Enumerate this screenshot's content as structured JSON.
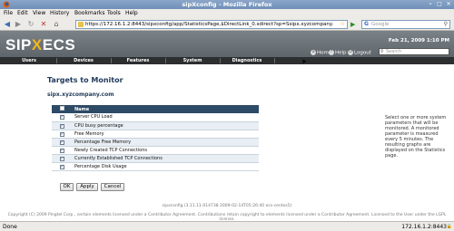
{
  "window": {
    "title": "sipXconfig - Mozilla Firefox"
  },
  "menu": [
    "File",
    "Edit",
    "View",
    "History",
    "Bookmarks",
    "Tools",
    "Help"
  ],
  "browser": {
    "url": "https://172.16.1.2:8443/sipxconfig/app/StatisticsPage,$DirectLink_0.sdirect?sp=Ssipx.xyzcompany.",
    "search_placeholder": "Google"
  },
  "app": {
    "logo_left": "SIP",
    "logo_x": "X",
    "logo_right": "ECS",
    "date": "Feb 21, 2009 1:10 PM",
    "links": {
      "home": "Home",
      "help": "Help",
      "logout": "Logout"
    },
    "search_placeholder": "Search",
    "nav": [
      "Users",
      "Devices",
      "Features",
      "System",
      "Diagnostics"
    ]
  },
  "page": {
    "heading": "Targets to Monitor",
    "server": "sipx.xyzcompany.com",
    "table": {
      "column_name": "Name",
      "rows": [
        {
          "checked": true,
          "name": "Server CPU Load"
        },
        {
          "checked": true,
          "name": "CPU busy percentage"
        },
        {
          "checked": true,
          "name": "Free Memory"
        },
        {
          "checked": true,
          "name": "Percentage Free Memory"
        },
        {
          "checked": true,
          "name": "Newly Created TCP Connections"
        },
        {
          "checked": true,
          "name": "Currently Established TCP Connections"
        },
        {
          "checked": true,
          "name": "Percentage Disk Usage"
        }
      ]
    },
    "buttons": {
      "ok": "OK",
      "apply": "Apply",
      "cancel": "Cancel"
    },
    "sidenote": "Select one or more system parameters that will be monitored. A monitored parameter is measured every 5 minutes. The resulting graphs are displayed on the Statistics page.",
    "footer_version": "sipxconfig (3.11.11-014738 2009-02-14T05:26:40 ecs-centos5)",
    "footer_copyright": "Copyright (C) 2009 Pingtel Corp., certain elements licensed under a Contributor Agreement. Contributions retain copyright to elements licensed under a Contributor Agreement. Licensed to the User under the LGPL license."
  },
  "status": {
    "text": "Done",
    "host": "172.16.1.2:8443"
  },
  "colors": {
    "header_gray": "#6b7278",
    "nav_dark": "#2c2e30",
    "table_header": "#2d4a66",
    "logo_accent": "#f2b51c"
  }
}
